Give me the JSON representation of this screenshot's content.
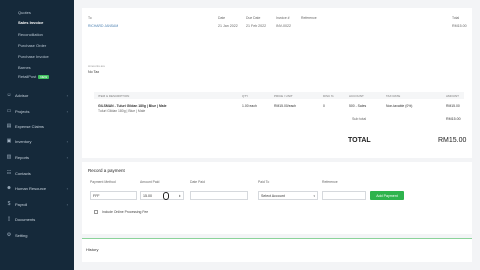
{
  "sidebar": {
    "sales_sub": [
      "Quotes",
      "Sales Invoice",
      "Reconciliation",
      "Purchase Order",
      "Purchase Invoice",
      "Barnes",
      "RetailPost"
    ],
    "new_badge": "NEW",
    "nav": [
      {
        "label": "Advisor",
        "icon": "person-icon"
      },
      {
        "label": "Projects",
        "icon": "folder-icon"
      },
      {
        "label": "Expense Claims",
        "icon": "receipt-icon"
      },
      {
        "label": "Inventory",
        "icon": "box-icon"
      },
      {
        "label": "Reports",
        "icon": "chart-icon"
      },
      {
        "label": "Contacts",
        "icon": "contacts-icon"
      },
      {
        "label": "Human Resource",
        "icon": "people-icon"
      },
      {
        "label": "Payroll",
        "icon": "payroll-icon"
      },
      {
        "label": "Documents",
        "icon": "document-icon"
      },
      {
        "label": "Setting",
        "icon": "gear-icon"
      }
    ]
  },
  "invoice": {
    "to_label": "To",
    "to_value": "RICHARD JANSAM",
    "date_label": "Date",
    "date_value": "21 Jan 2022",
    "due_label": "Due Date",
    "due_value": "21 Feb 2022",
    "invno_label": "Invoice #",
    "invno_value": "INV-0022",
    "ref_label": "Reference",
    "total_label": "Total",
    "total_value": "RM15.00",
    "amounts_label": "Amounts are",
    "amounts_value": "No Tax"
  },
  "table": {
    "headers": [
      "ITEM & DESCRIPTION",
      "QTY",
      "PRICE / UNIT",
      "DISC %",
      "ACCOUNT",
      "TAX RATE",
      "AMOUNT"
    ],
    "row": {
      "item": "GILSMAN - Tuluri Gildan 180g | Blue | Male",
      "desc": "Tuluri Gildan 180g | Blue | Male",
      "qty": "1.00 each",
      "price": "RM15.00/each",
      "disc": "0",
      "account": "500 - Sales",
      "tax": "Non-taxable (0%)",
      "amount": "RM15.00"
    },
    "subtotal_label": "Sub total",
    "subtotal_value": "RM15.00",
    "total_label": "TOTAL",
    "total_value": "RM15.00"
  },
  "payment": {
    "title": "Record a payment",
    "method_label": "Payment Method",
    "method_value": "FFF",
    "amount_label": "Amount Paid",
    "amount_value": "15.00",
    "date_label": "Date Paid",
    "paidto_label": "Paid To",
    "paidto_value": "Select Account",
    "ref_label": "Reference",
    "add_button": "Add Payment",
    "checkbox_label": "Include Online Processing Fee"
  },
  "history": {
    "title": "History"
  },
  "colors": {
    "sidebar": "#15293a",
    "accent": "#2eb34d",
    "link": "#4a7fb0"
  }
}
